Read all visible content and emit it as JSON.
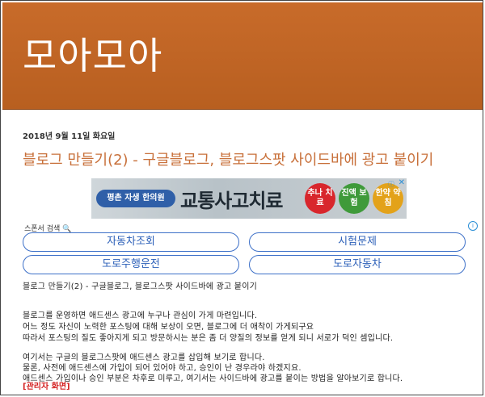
{
  "blog": {
    "title": "모아모아"
  },
  "post": {
    "date": "2018년 9월 11일 화요일",
    "title": "블로그 만들기(2) - 구글블로그, 블로그스팟 사이드바에 광고 붙이기"
  },
  "ad": {
    "clinic": "평촌 자생 한의원",
    "headline": "교통사고치료",
    "badges": [
      "추나 치료",
      "진액 보험",
      "한약 약침"
    ],
    "badge_colors": [
      "#d8262c",
      "#3f9a3a",
      "#e3a21a"
    ]
  },
  "sponsor": {
    "label": "스폰서 검색"
  },
  "links": [
    {
      "label": "자동차조회"
    },
    {
      "label": "시험문제"
    },
    {
      "label": "도로주행운전"
    },
    {
      "label": "도로자동차"
    }
  ],
  "content": {
    "subtitle": "블로그 만들기(2) - 구글블로그, 블로그스팟 사이드바에 광고 붙이기",
    "para1": [
      "블로그를 운영하면 애드센스 광고에 누구나 관심이 가게 마련입니다.",
      "어느 정도 자신이 노력한 포스팅에 대해 보상이 오면, 블로그에 더 애착이 가게되구요",
      "따라서 포스팅의 질도 좋아지게 되고 방문하시는 분은 좀 더 양질의 정보를 얻게 되니 서로가 덕인 셈입니다."
    ],
    "para2": [
      "여기서는 구글의 블로그스팟에 애드센스 광고를 삽입해 보기로 합니다.",
      "물론, 사전에 애드센스에 가입이 되어 있어야 하고, 승인이 난 경우라야 하겠지요.",
      "애드센스 가입이나 승인 부분은 차후로 미루고, 여기서는 사이드바에 광고를 붙이는 방법을 알아보기로 합니다."
    ],
    "admin_tag": "[관리자 화면]"
  }
}
